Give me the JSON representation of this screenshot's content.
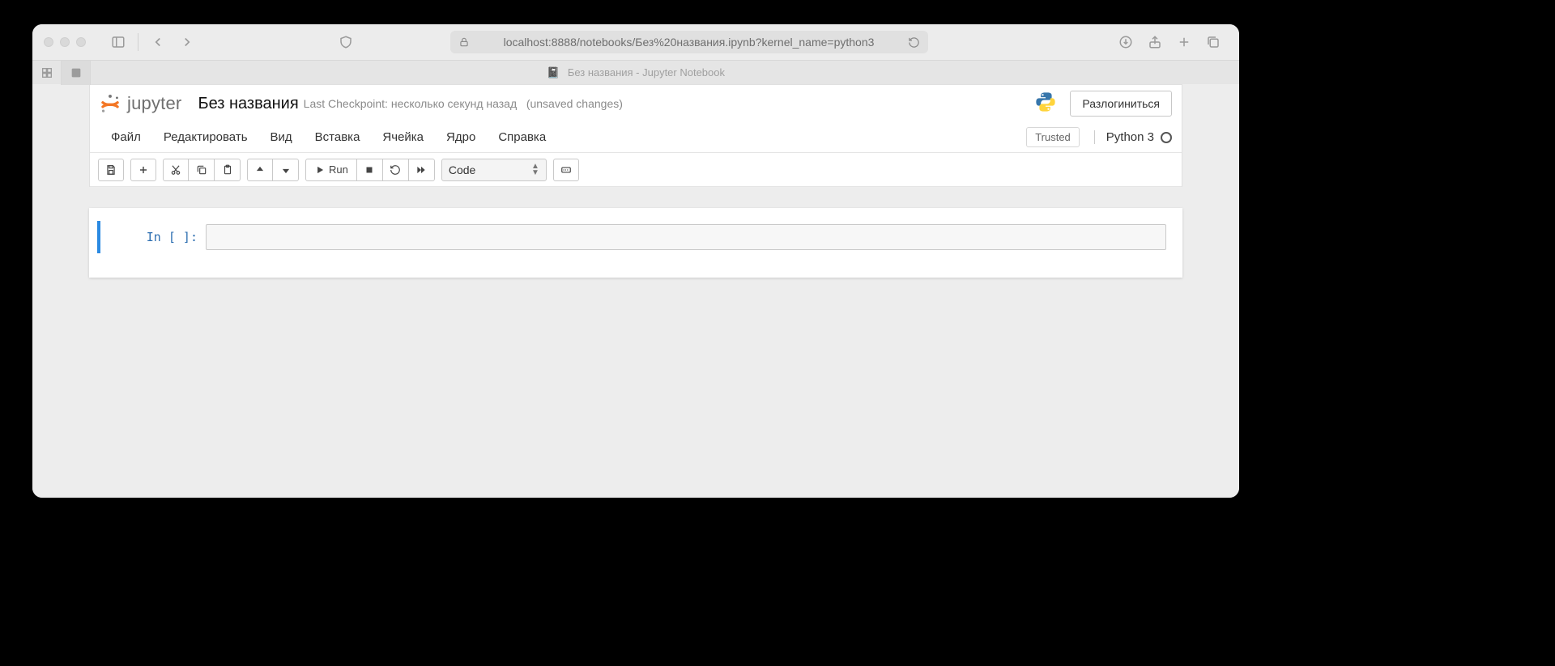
{
  "browser": {
    "url": "localhost:8888/notebooks/Без%20названия.ipynb?kernel_name=python3",
    "tab_title": "Без названия - Jupyter Notebook"
  },
  "jupyter": {
    "brand": "jupyter",
    "notebook_title": "Без названия",
    "checkpoint_label": "Last Checkpoint:",
    "checkpoint_time": "несколько секунд назад",
    "unsaved_label": "(unsaved changes)",
    "logout_label": "Разлогиниться",
    "trusted_label": "Trusted",
    "kernel_label": "Python 3",
    "menus": [
      "Файл",
      "Редактировать",
      "Вид",
      "Вставка",
      "Ячейка",
      "Ядро",
      "Справка"
    ],
    "toolbar": {
      "run_label": "Run",
      "cell_type": "Code"
    },
    "cell": {
      "prompt": "In [ ]:"
    }
  }
}
